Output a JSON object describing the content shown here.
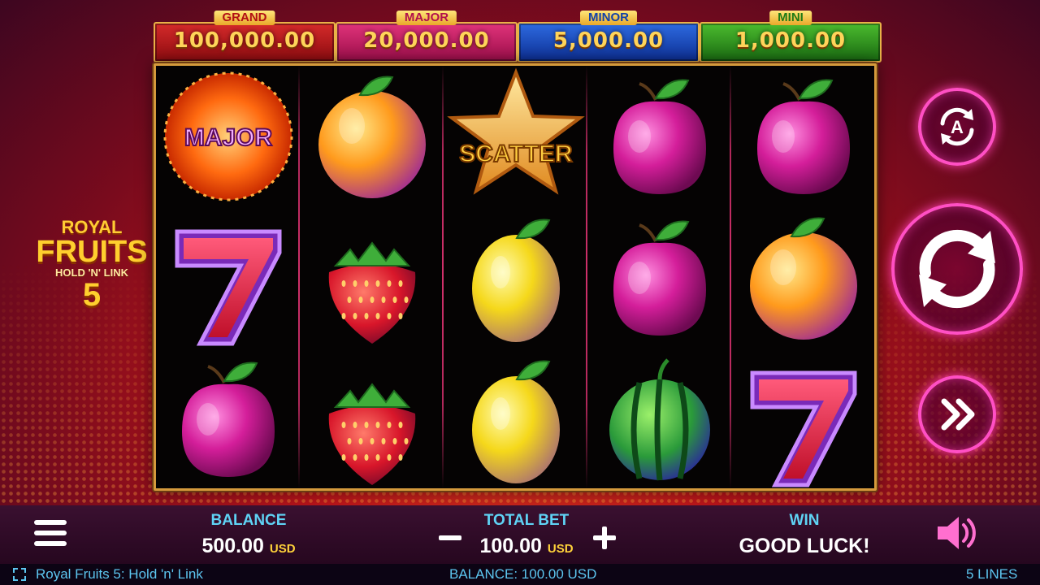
{
  "jackpots": {
    "grand": {
      "label": "GRAND",
      "value": "100,000.00"
    },
    "major": {
      "label": "MAJOR",
      "value": "20,000.00"
    },
    "minor": {
      "label": "MINOR",
      "value": "5,000.00"
    },
    "mini": {
      "label": "MINI",
      "value": "1,000.00"
    }
  },
  "logo": {
    "line1": "ROYAL",
    "line2": "FRUITS",
    "line3": "HOLD 'N' LINK",
    "line4": "5"
  },
  "reels": [
    [
      "major-sun",
      "seven",
      "plum"
    ],
    [
      "orange",
      "strawberry",
      "strawberry"
    ],
    [
      "scatter-star",
      "lemon",
      "lemon"
    ],
    [
      "plum",
      "plum",
      "watermelon"
    ],
    [
      "plum",
      "orange",
      "seven"
    ]
  ],
  "symbols": {
    "major_text": "MAJOR",
    "scatter_text": "SCATTER"
  },
  "bottom": {
    "balance_label": "BALANCE",
    "balance_value": "500.00",
    "balance_currency": "USD",
    "bet_label": "TOTAL BET",
    "bet_value": "100.00",
    "bet_currency": "USD",
    "win_label": "WIN",
    "win_value": "GOOD LUCK!"
  },
  "footer": {
    "title": "Royal Fruits 5: Hold 'n' Link",
    "balance": "BALANCE: 100.00 USD",
    "lines": "5 LINES"
  },
  "icons": {
    "menu": "hamburger-icon",
    "minus": "minus-icon",
    "plus": "plus-icon",
    "sound": "speaker-icon",
    "auto": "autoplay-icon",
    "spin": "spin-arrows-icon",
    "turbo": "fast-forward-icon",
    "fullscreen": "fullscreen-icon"
  },
  "colors": {
    "accent_neon": "#ff4fc4",
    "label_cyan": "#5fd3f5",
    "gold": "#ffd45a"
  }
}
